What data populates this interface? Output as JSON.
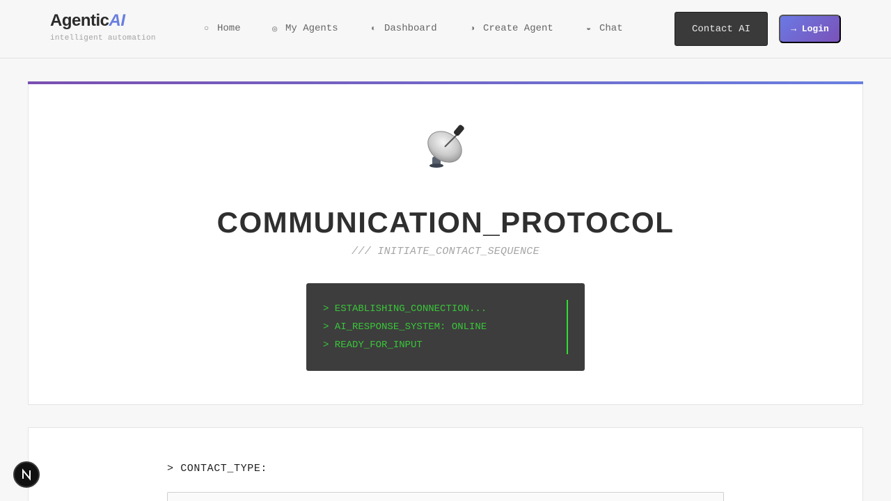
{
  "brand": {
    "name": "Agentic",
    "accent": "AI",
    "tagline": "intelligent automation"
  },
  "nav": [
    {
      "icon": "○",
      "icon_name": "circle-icon",
      "label": "Home"
    },
    {
      "icon": "◎",
      "icon_name": "target-icon",
      "label": "My Agents"
    },
    {
      "icon": "◐",
      "icon_name": "half-circle-icon",
      "label": "Dashboard"
    },
    {
      "icon": "◑",
      "icon_name": "half-circle-right-icon",
      "label": "Create Agent"
    },
    {
      "icon": "◒",
      "icon_name": "half-circle-bottom-icon",
      "label": "Chat"
    }
  ],
  "header": {
    "contact_label": "Contact AI",
    "login_label": "→ Login"
  },
  "hero": {
    "icon_name": "satellite-dish-icon",
    "title": "COMMUNICATION_PROTOCOL",
    "subtitle": "/// INITIATE_CONTACT_SEQUENCE",
    "terminal": [
      "> ESTABLISHING_CONNECTION...",
      "> AI_RESPONSE_SYSTEM: ONLINE",
      "> READY_FOR_INPUT"
    ]
  },
  "form": {
    "contact_type_label": "> CONTACT_TYPE:"
  },
  "colors": {
    "accent": "#6a7fe0",
    "gradient_end": "#7a52b8",
    "terminal_bg": "#3d3d3d",
    "terminal_text": "#39c639"
  }
}
